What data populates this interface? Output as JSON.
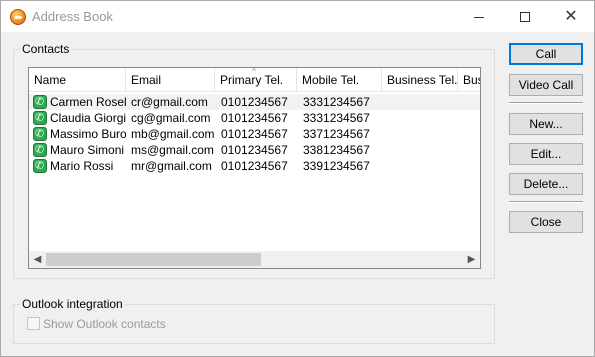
{
  "window": {
    "title": "Address Book"
  },
  "contacts_group": {
    "label": "Contacts"
  },
  "listview": {
    "columns": [
      "Name",
      "Email",
      "Primary Tel.",
      "Mobile Tel.",
      "Business Tel.",
      "Bus"
    ],
    "sort_indicator": "^",
    "rows": [
      {
        "name": "Carmen Rosella",
        "email": "cr@gmail.com",
        "primary": "0101234567",
        "mobile": "3331234567"
      },
      {
        "name": "Claudia Giorgi",
        "email": "cg@gmail.com",
        "primary": "0101234567",
        "mobile": "3331234567"
      },
      {
        "name": "Massimo Buroni",
        "email": "mb@gmail.com",
        "primary": "0101234567",
        "mobile": "3371234567"
      },
      {
        "name": "Mauro Simoni",
        "email": "ms@gmail.com",
        "primary": "0101234567",
        "mobile": "3381234567"
      },
      {
        "name": "Mario Rossi",
        "email": "mr@gmail.com",
        "primary": "0101234567",
        "mobile": "3391234567"
      }
    ]
  },
  "buttons": {
    "call": "Call",
    "video_call": "Video Call",
    "new": "New...",
    "edit": "Edit...",
    "delete": "Delete...",
    "close": "Close"
  },
  "outlook_group": {
    "label": "Outlook integration",
    "show_contacts": "Show Outlook contacts",
    "show_contacts_checked": false,
    "enabled": false
  },
  "icons": {
    "app": "address-book-icon",
    "contact": "phone-icon"
  },
  "colors": {
    "accent": "#0078d7",
    "phone_icon": "#2fa84f"
  }
}
